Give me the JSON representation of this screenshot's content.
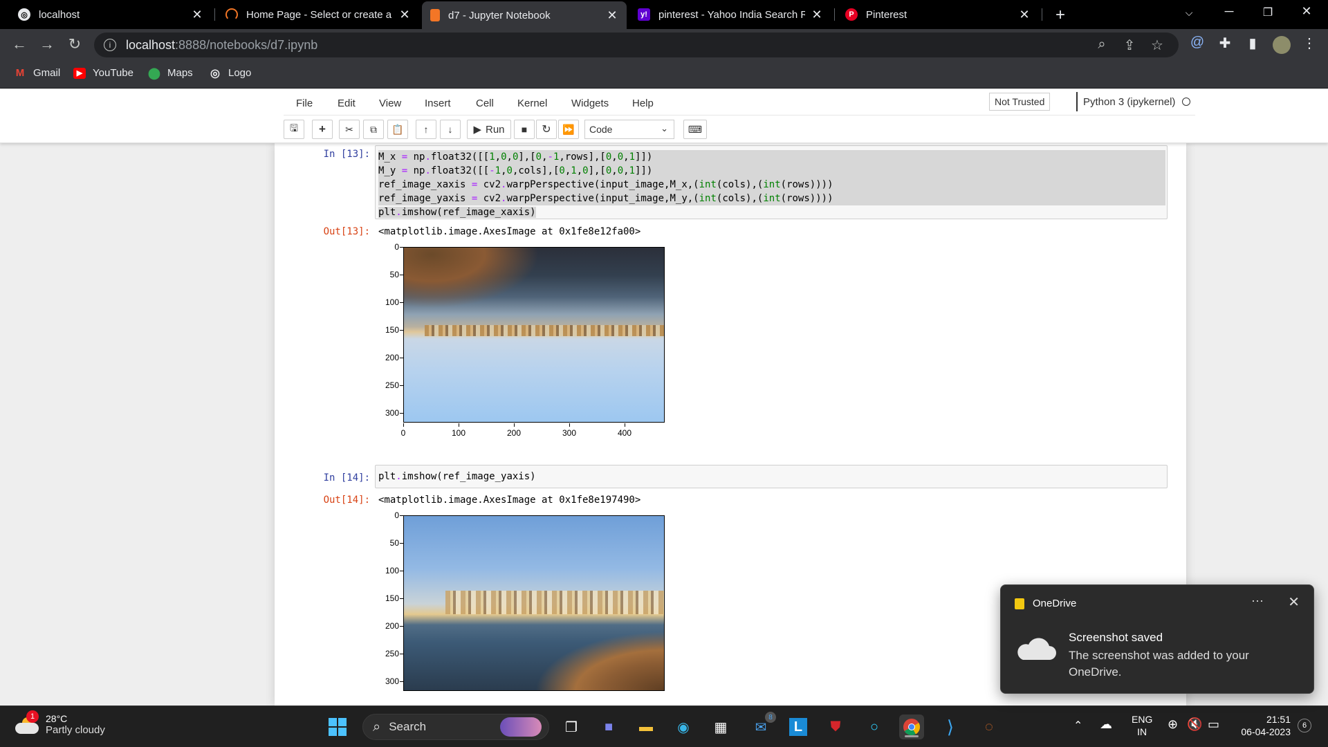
{
  "browser": {
    "tabs": [
      {
        "title": "localhost",
        "active": false
      },
      {
        "title": "Home Page - Select or create a n",
        "active": false
      },
      {
        "title": "d7 - Jupyter Notebook",
        "active": true
      },
      {
        "title": "pinterest - Yahoo India Search Re",
        "active": false
      },
      {
        "title": "Pinterest",
        "active": false
      }
    ],
    "new_tab": "+",
    "url_host": "localhost",
    "url_path": ":8888/notebooks/d7.ipynb",
    "bookmarks": [
      {
        "label": "Gmail",
        "color": "#ea4335"
      },
      {
        "label": "YouTube",
        "color": "#ff0000"
      },
      {
        "label": "Maps",
        "color": "#34a853"
      },
      {
        "label": "Logo",
        "color": "#9aa0a6"
      }
    ]
  },
  "jupyter": {
    "menu": [
      "File",
      "Edit",
      "View",
      "Insert",
      "Cell",
      "Kernel",
      "Widgets",
      "Help"
    ],
    "trust": "Not Trusted",
    "kernel": "Python 3 (ipykernel)",
    "run_label": "Run",
    "cell_type": "Code"
  },
  "cells": {
    "c13": {
      "in_prompt": "In [13]:",
      "out_prompt": "Out[13]:",
      "lines": [
        "M_x = np.float32([[1,0,0],[0,-1,rows],[0,0,1]])",
        "M_y = np.float32([[-1,0,cols],[0,1,0],[0,0,1]])",
        "ref_image_xaxis = cv2.warpPerspective(input_image,M_x,(int(cols),(int(rows))))",
        "ref_image_yaxis = cv2.warpPerspective(input_image,M_y,(int(cols),(int(rows))))",
        "plt.imshow(ref_image_xaxis)"
      ],
      "output": "<matplotlib.image.AxesImage at 0x1fe8e12fa00>"
    },
    "c14": {
      "in_prompt": "In [14]:",
      "out_prompt": "Out[14]:",
      "lines": [
        "plt.imshow(ref_image_yaxis)"
      ],
      "output": "<matplotlib.image.AxesImage at 0x1fe8e197490>"
    }
  },
  "plot1": {
    "yticks": [
      "0",
      "50",
      "100",
      "150",
      "200",
      "250",
      "300"
    ],
    "xticks": [
      "0",
      "100",
      "200",
      "300",
      "400"
    ]
  },
  "plot2": {
    "yticks": [
      "0",
      "50",
      "100",
      "150",
      "200",
      "250",
      "300"
    ]
  },
  "toast": {
    "app": "OneDrive",
    "title": "Screenshot saved",
    "body": "The screenshot was added to your OneDrive.",
    "more": "···",
    "close": "✕"
  },
  "taskbar": {
    "temp": "28°C",
    "condition": "Partly cloudy",
    "weather_badge": "1",
    "search": "Search",
    "lang_top": "ENG",
    "lang_bottom": "IN",
    "time": "21:51",
    "date": "06-04-2023",
    "notif_count": "6",
    "mail_badge": "8"
  }
}
